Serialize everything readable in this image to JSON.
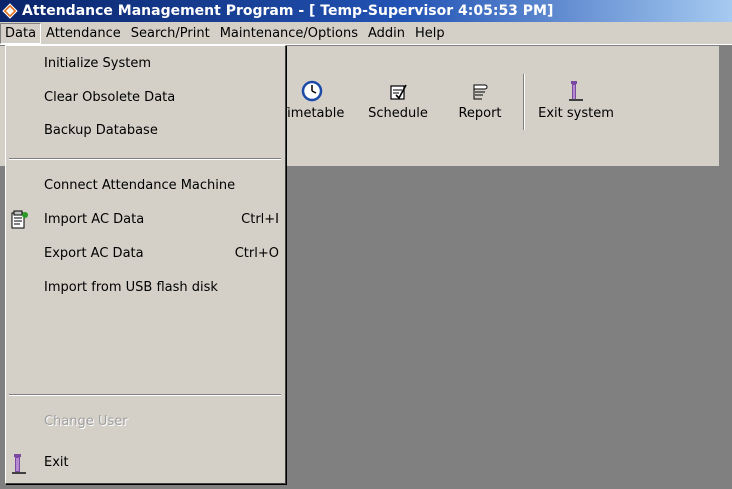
{
  "title": "Attendance Management Program - [ Temp-Supervisor 4:05:53 PM]",
  "menubar": [
    "Data",
    "Attendance",
    "Search/Print",
    "Maintenance/Options",
    "Addin",
    "Help"
  ],
  "toolbar": {
    "buttons": [
      {
        "label": "Timetable",
        "icon": "clock-icon"
      },
      {
        "label": "Schedule",
        "icon": "schedule-icon"
      },
      {
        "label": "Report",
        "icon": "report-icon"
      },
      {
        "label": "Exit system",
        "icon": "exit-door-icon"
      }
    ]
  },
  "data_menu": {
    "items": [
      {
        "label": "Initialize System",
        "shortcut": ""
      },
      {
        "label": "Clear Obsolete Data",
        "shortcut": ""
      },
      {
        "label": "Backup Database",
        "shortcut": ""
      },
      {
        "label": "Connect Attendance Machine",
        "shortcut": ""
      },
      {
        "label": "Import AC Data",
        "shortcut": "Ctrl+I",
        "icon": "import-data-icon"
      },
      {
        "label": "Export AC Data",
        "shortcut": "Ctrl+O"
      },
      {
        "label": "Import from USB flash disk",
        "shortcut": ""
      },
      {
        "label": "Change User",
        "shortcut": "",
        "disabled": true
      },
      {
        "label": "Exit",
        "shortcut": "",
        "icon": "exit-door-icon"
      }
    ]
  },
  "colors": {
    "title_gradient_start": "#0a246a",
    "title_gradient_end": "#a6caf0",
    "face": "#d4d0c8",
    "workspace": "#808080"
  }
}
